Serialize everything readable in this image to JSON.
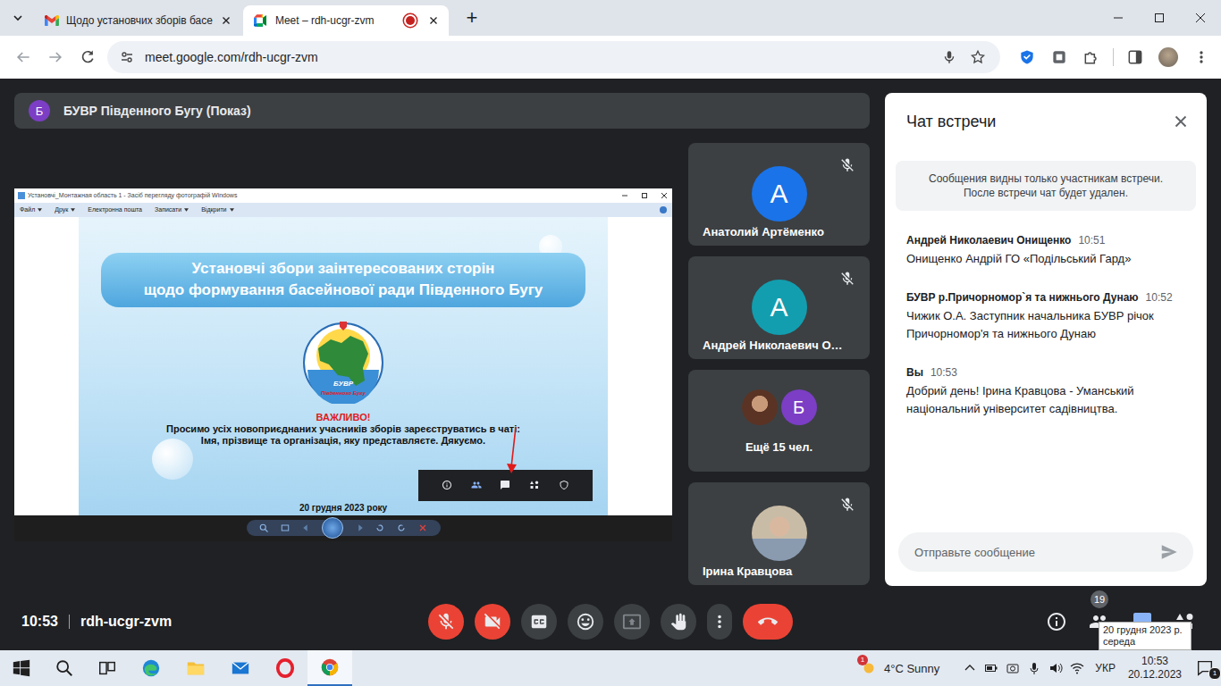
{
  "browser": {
    "tabs": [
      {
        "label": "Щодо установчих зборів басе",
        "selected": false,
        "recording": false,
        "kind": "mail"
      },
      {
        "label": "Meet – rdh-ucgr-zvm",
        "selected": true,
        "recording": true,
        "kind": "meeting"
      }
    ],
    "new_tab": "+",
    "url": "meet.google.com/rdh-ucgr-zvm"
  },
  "meeting": {
    "header": {
      "avatar": "Б",
      "title": "БУВР Південного Бугу (Показ)"
    },
    "presentation": {
      "window_title": "Установчі_Монтажная область 1 - Засіб перегляду фотографій Windows",
      "menu": [
        {
          "label": "Файл",
          "dropdown": true
        },
        {
          "label": "Друк",
          "dropdown": true
        },
        {
          "label": "Електронна пошта",
          "dropdown": false
        },
        {
          "label": "Записати",
          "dropdown": true
        },
        {
          "label": "Відкрити",
          "dropdown": true
        }
      ],
      "slide": {
        "title": [
          "Установчі збори заінтересованих сторін",
          "щодо формування басейнової ради Південного Бугу"
        ],
        "logo": {
          "title": "БУВР",
          "subtitle": "Південного Бугу"
        },
        "important": "ВАЖЛИВО!",
        "message": [
          "Просимо усіх новоприєднаних учасників зборів зареєструватись в чаті:",
          "Імя, прізвище та організація, яку представляєте. Дякуємо."
        ],
        "date": "20 грудня 2023 року"
      }
    },
    "tiles": [
      {
        "kind": "avatar",
        "name": "Анатолий Артёменко",
        "avatar": "А",
        "color": "#1a73e8",
        "muted": true
      },
      {
        "kind": "avatar",
        "name": "Андрей Николаевич О…",
        "avatar": "А",
        "color": "#129eaf",
        "muted": true
      },
      {
        "kind": "group",
        "name": "Ещё 15 чел.",
        "avatar": "Б",
        "color": "#7b3ec4",
        "muted": false
      },
      {
        "kind": "photo",
        "name": "Ірина Кравцова",
        "avatar": "",
        "color": "#c9bca6",
        "muted": true
      }
    ],
    "chat": {
      "title": "Чат встречи",
      "notice": [
        "Сообщения видны только участникам встречи.",
        "После встречи чат будет удален."
      ],
      "messages": [
        {
          "sender": "Андрей Николаевич Онищенко",
          "time": "10:51",
          "text": "Онищенко Андрій ГО «Подільський Гард»"
        },
        {
          "sender": "БУВР р.Причорномор`я та нижнього Дунаю",
          "time": "10:52",
          "text": "Чижик О.А. Заступник начальника БУВР річок Причорномор'я та нижнього Дунаю"
        },
        {
          "sender": "Вы",
          "time": "10:53",
          "text": "Добрий день! Ірина Кравцова - Уманський національний університет садівництва."
        }
      ],
      "placeholder": "Отправьте сообщение"
    },
    "bar": {
      "time": "10:53",
      "code": "rdh-ucgr-zvm",
      "controls": [
        {
          "kind": "mic",
          "off": true,
          "disabled": false
        },
        {
          "kind": "camera",
          "off": true,
          "disabled": false
        },
        {
          "kind": "captions",
          "off": false,
          "disabled": false
        },
        {
          "kind": "emoji",
          "off": false,
          "disabled": false
        },
        {
          "kind": "present",
          "off": false,
          "disabled": true
        },
        {
          "kind": "hand",
          "off": false,
          "disabled": false
        },
        {
          "kind": "more",
          "off": false,
          "disabled": false
        },
        {
          "kind": "end",
          "off": false,
          "disabled": false
        }
      ],
      "side": [
        {
          "kind": "info",
          "selected": false,
          "badge": ""
        },
        {
          "kind": "people",
          "selected": false,
          "badge": "19"
        },
        {
          "kind": "chat",
          "selected": true,
          "badge": ""
        },
        {
          "kind": "activities",
          "selected": false,
          "badge": ""
        }
      ]
    },
    "tooltip": [
      "20 грудня 2023 р.",
      "середа"
    ]
  },
  "taskbar": {
    "apps": [
      {
        "kind": "edge",
        "active": false
      },
      {
        "kind": "explorer",
        "active": false
      },
      {
        "kind": "mail",
        "active": false
      },
      {
        "kind": "opera",
        "active": false
      },
      {
        "kind": "chrome",
        "active": true
      }
    ],
    "weather": {
      "badge": "1",
      "text": "4°C Sunny"
    },
    "language": "УКР",
    "time": "10:53",
    "date": "20.12.2023",
    "notifications": "1"
  }
}
